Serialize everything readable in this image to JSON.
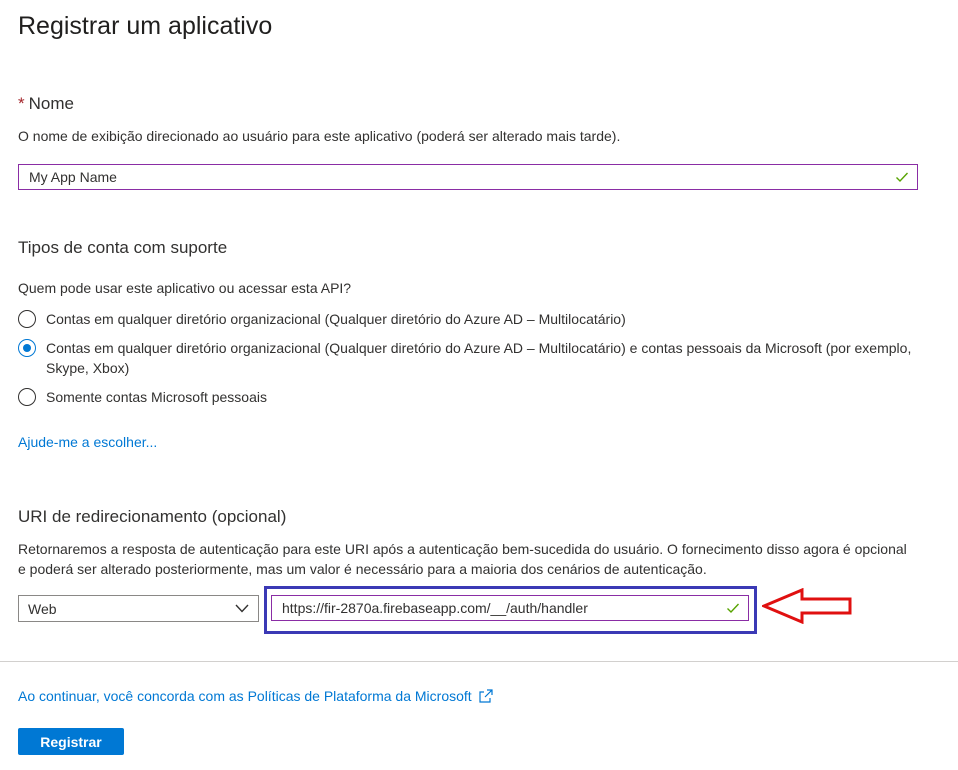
{
  "page": {
    "title": "Registrar um aplicativo"
  },
  "name_section": {
    "required_mark": "*",
    "label": "Nome",
    "description": "O nome de exibição direcionado ao usuário para este aplicativo (poderá ser alterado mais tarde).",
    "input_value": "My App Name"
  },
  "account_types": {
    "heading": "Tipos de conta com suporte",
    "question": "Quem pode usar este aplicativo ou acessar esta API?",
    "options": [
      {
        "label": "Contas em qualquer diretório organizacional (Qualquer diretório do Azure AD – Multilocatário)",
        "selected": false
      },
      {
        "label": "Contas em qualquer diretório organizacional (Qualquer diretório do Azure AD – Multilocatário) e contas pessoais da Microsoft (por exemplo, Skype, Xbox)",
        "selected": true
      },
      {
        "label": "Somente contas Microsoft pessoais",
        "selected": false
      }
    ],
    "help_link": "Ajude-me a escolher..."
  },
  "redirect": {
    "heading": "URI de redirecionamento (opcional)",
    "description": "Retornaremos a resposta de autenticação para este URI após a autenticação bem-sucedida do usuário. O fornecimento disso agora é opcional e poderá ser alterado posteriormente, mas um valor é necessário para a maioria dos cenários de autenticação.",
    "platform_value": "Web",
    "uri_value": "https://fir-2870a.firebaseapp.com/__/auth/handler"
  },
  "footer": {
    "policy_link": "Ao continuar, você concorda com as Políticas de Plataforma da Microsoft",
    "register_button": "Registrar"
  },
  "colors": {
    "accent": "#0078d4",
    "valid_check": "#57a300",
    "highlight_box": "#3b39b5",
    "annotation_arrow": "#e01010"
  },
  "icons": {
    "valid": "checkmark-icon",
    "dropdown": "chevron-down-icon",
    "external": "external-link-icon",
    "annotation": "arrow-left-annotation"
  }
}
